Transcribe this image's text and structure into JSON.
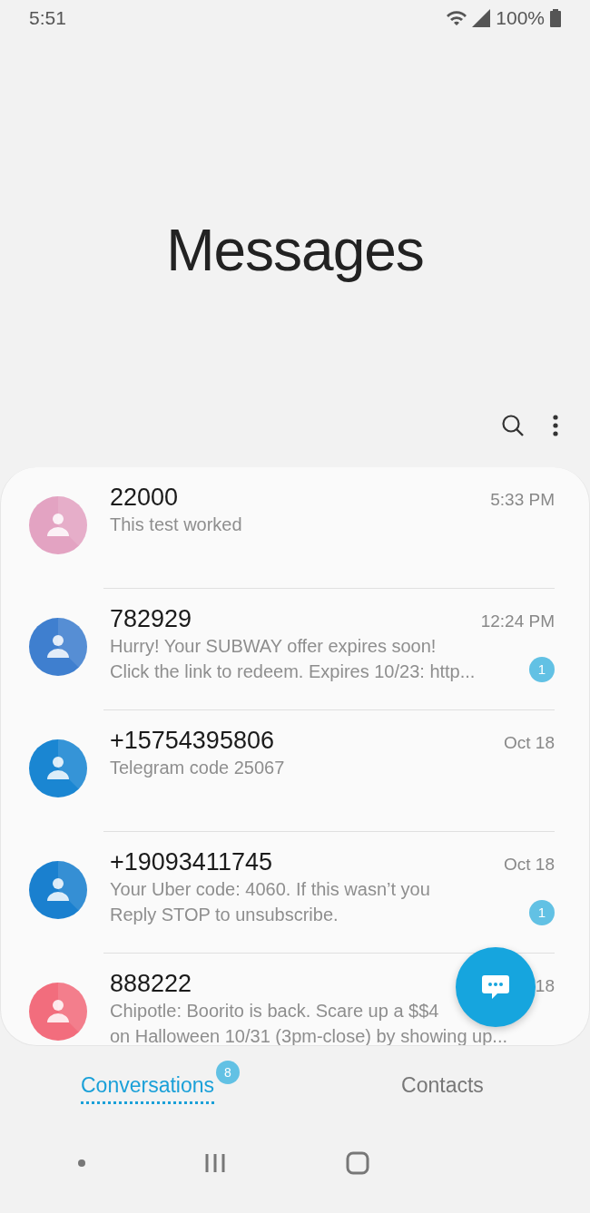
{
  "status_bar": {
    "time": "5:51",
    "battery": "100%"
  },
  "title": "Messages",
  "conversations": [
    {
      "name": "22000",
      "time": "5:33 PM",
      "preview": [
        "This test worked"
      ],
      "color": "#e3a3c2"
    },
    {
      "name": "782929",
      "time": "12:24 PM",
      "preview": [
        "Hurry! Your SUBWAY offer expires soon!",
        "Click the link to redeem. Expires 10/23: http..."
      ],
      "unread": "1",
      "color": "#3f7fcf"
    },
    {
      "name": "+15754395806",
      "time": "Oct 18",
      "preview": [
        "Telegram code 25067"
      ],
      "color": "#1a86d2"
    },
    {
      "name": "+19093411745",
      "time": "Oct 18",
      "preview": [
        "Your Uber code: 4060. If this wasn’t you",
        "Reply STOP to unsubscribe."
      ],
      "unread": "1",
      "color": "#1a80cf"
    },
    {
      "name": "888222",
      "time": "18",
      "preview": [
        "Chipotle: Boorito is back. Scare up a $$4",
        "on Halloween 10/31 (3pm-close) by showing up..."
      ],
      "color": "#f26d7d"
    }
  ],
  "tabs": [
    {
      "label": "Conversations",
      "badge": "8",
      "selected": true
    },
    {
      "label": "Contacts",
      "selected": false
    }
  ]
}
